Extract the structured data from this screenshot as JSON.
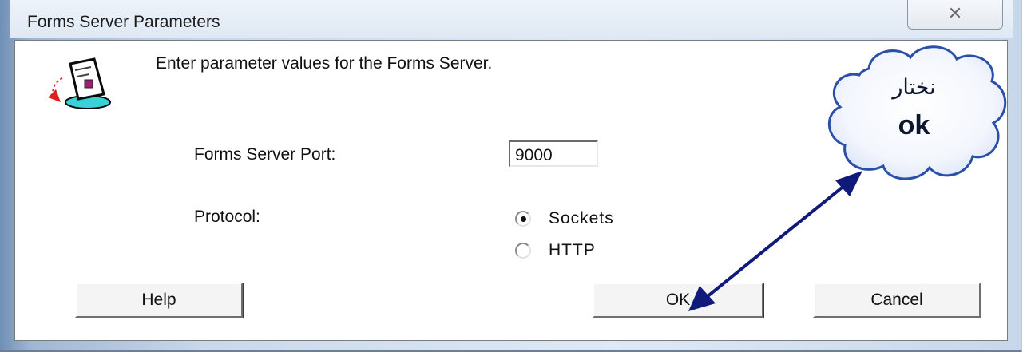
{
  "window": {
    "title": "Forms Server Parameters",
    "close_glyph": "✕"
  },
  "dialog": {
    "prompt": "Enter parameter values for the Forms Server.",
    "port_label": "Forms Server Port:",
    "port_value": "9000",
    "protocol_label": "Protocol:",
    "protocol_options": [
      {
        "label": "Sockets",
        "selected": true
      },
      {
        "label": "HTTP",
        "selected": false
      }
    ]
  },
  "buttons": {
    "help": "Help",
    "ok": "OK",
    "cancel": "Cancel"
  },
  "annotation": {
    "line1": "نختار",
    "line2": "ok",
    "arrow_color": "#101a7a",
    "cloud_border": "#2a4fa8"
  },
  "icons": {
    "app_icon": "forms-server-icon",
    "close": "close-icon"
  }
}
